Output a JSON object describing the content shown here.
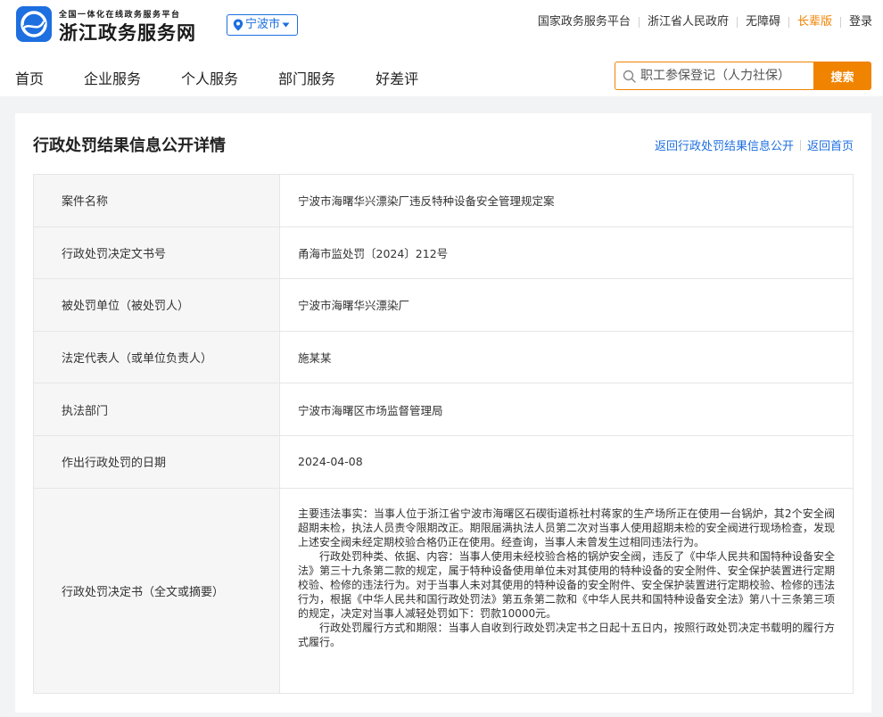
{
  "header": {
    "logo_subtitle": "全国一体化在线政务服务平台",
    "logo_title": "浙江政务服务网",
    "city": "宁波市",
    "top_links": [
      "国家政务服务平台",
      "浙江省人民政府",
      "无障碍",
      "长辈版",
      "登录"
    ]
  },
  "nav": {
    "items": [
      "首页",
      "企业服务",
      "个人服务",
      "部门服务",
      "好差评"
    ]
  },
  "search": {
    "placeholder": "职工参保登记（人力社保）",
    "button": "搜索"
  },
  "main": {
    "title": "行政处罚结果信息公开详情",
    "back_links": [
      "返回行政处罚结果信息公开",
      "返回首页"
    ],
    "rows": [
      {
        "label": "案件名称",
        "value": "宁波市海曙华兴漂染厂违反特种设备安全管理规定案"
      },
      {
        "label": "行政处罚决定文书号",
        "value": "甬海市监处罚〔2024〕212号"
      },
      {
        "label": "被处罚单位（被处罚人）",
        "value": "宁波市海曙华兴漂染厂"
      },
      {
        "label": "法定代表人（或单位负责人）",
        "value": "施某某"
      },
      {
        "label": "执法部门",
        "value": "宁波市海曙区市场监督管理局"
      },
      {
        "label": "作出行政处罚的日期",
        "value": "2024-04-08"
      }
    ],
    "decision": {
      "label": "行政处罚决定书（全文或摘要）",
      "paragraphs": [
        "主要违法事实：当事人位于浙江省宁波市海曙区石碶街道栎社村蒋家的生产场所正在使用一台锅炉，其2个安全阀超期未检，执法人员责令限期改正。期限届满执法人员第二次对当事人使用超期未检的安全阀进行现场检查，发现上述安全阀未经定期校验合格仍正在使用。经查询，当事人未曾发生过相同违法行为。",
        "行政处罚种类、依据、内容：当事人使用未经校验合格的锅炉安全阀，违反了《中华人民共和国特种设备安全法》第三十九条第二款的规定，属于特种设备使用单位未对其使用的特种设备的安全附件、安全保护装置进行定期校验、检修的违法行为。对于当事人未对其使用的特种设备的安全附件、安全保护装置进行定期校验、检修的违法行为，根据《中华人民共和国行政处罚法》第五条第二款和《中华人民共和国特种设备安全法》第八十三条第三项的规定，决定对当事人减轻处罚如下：罚款10000元。",
        "行政处罚履行方式和期限：当事人自收到行政处罚决定书之日起十五日内，按照行政处罚决定书载明的履行方式履行。"
      ]
    }
  },
  "colors": {
    "brand_blue": "#1e6fe0",
    "accent_orange": "#f08300"
  }
}
